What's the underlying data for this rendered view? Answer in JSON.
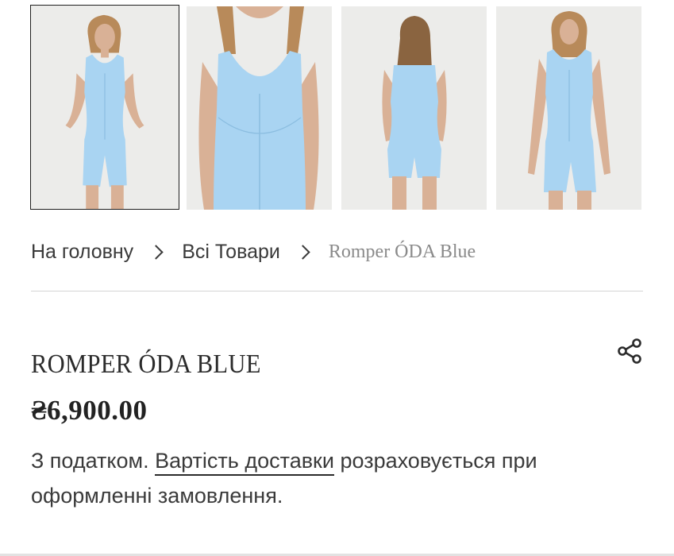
{
  "gallery": {
    "images": [
      {
        "alt": "front-full",
        "icon": "product-photo",
        "selected": true
      },
      {
        "alt": "front-closeup",
        "icon": "product-photo",
        "selected": false
      },
      {
        "alt": "back-full",
        "icon": "product-photo",
        "selected": false
      },
      {
        "alt": "front-full-alt",
        "icon": "product-photo",
        "selected": false
      }
    ],
    "garment_color": "#a9d4f2",
    "background_color": "#ececea"
  },
  "breadcrumb": {
    "home": "На головну",
    "all_products": "Всі Товари",
    "current": "Romper ÓDA Blue"
  },
  "product": {
    "title": "ROMPER ÓDA BLUE",
    "price": "₴6,900.00",
    "tax_prefix": "З податком.",
    "shipping_link": "Вартість доставки",
    "tax_suffix": "розраховується при оформленні замовлення."
  },
  "share": {
    "icon": "share-icon"
  }
}
